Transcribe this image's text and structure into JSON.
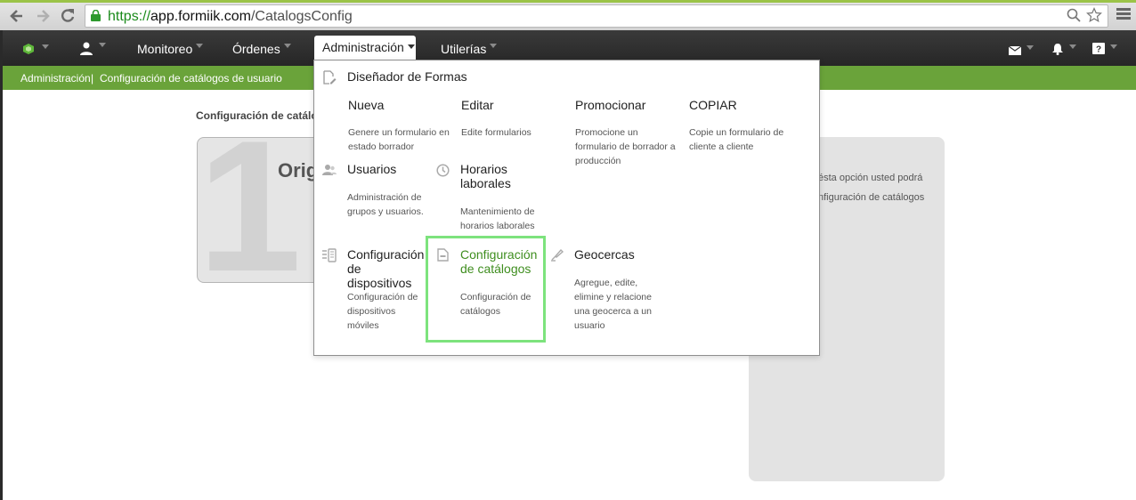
{
  "browser": {
    "url_scheme": "https://",
    "url_host": "app.formiik.com",
    "url_path": "/CatalogsConfig",
    "back_icon": "back-arrow-icon",
    "forward_icon": "forward-arrow-icon",
    "reload_icon": "reload-icon",
    "lock_icon": "lock-icon",
    "zoom_icon": "magnifier-icon",
    "star_icon": "star-icon",
    "menu_icon": "hamburger-menu-icon"
  },
  "appbar": {
    "monitoreo": "Monitoreo",
    "ordenes": "Órdenes",
    "administracion": "Administración",
    "utilerias": "Utilerías"
  },
  "breadcrumb": {
    "first": "Administración",
    "separator": "|",
    "second": "Configuración de catálogos de usuario"
  },
  "page": {
    "heading": "Configuración de catálo",
    "step_number": "1",
    "step_title": "Orig",
    "info_line1": "ésta opción usted podrá",
    "info_line2": "nfiguración de catálogos"
  },
  "menu": {
    "designer_title": "Diseñador de Formas",
    "nueva": {
      "title": "Nueva",
      "desc": "Genere un formulario en estado borrador"
    },
    "editar": {
      "title": "Editar",
      "desc": "Edite formularios"
    },
    "promocionar": {
      "title": "Promocionar",
      "desc": "Promocione un formulario de borrador a producción"
    },
    "copiar": {
      "title": "COPIAR",
      "desc": "Copie un formulario de cliente a cliente"
    },
    "usuarios": {
      "title": "Usuarios",
      "desc": "Administración de grupos y usuarios."
    },
    "horarios": {
      "title": "Horarios laborales",
      "desc": "Mantenimiento de horarios laborales"
    },
    "dispositivos": {
      "title": "Configuración de dispositivos",
      "desc": "Configuración de dispositivos móviles"
    },
    "catalogos": {
      "title": "Configuración de catálogos",
      "desc": "Configuración de catálogos"
    },
    "geocercas": {
      "title": "Geocercas",
      "desc": "Agregue, edite, elimine y relacione una geocerca a un usuario"
    }
  },
  "colors": {
    "brand_green": "#6aa33a",
    "active_link": "#3f8e1f",
    "highlight": "#7de37d"
  }
}
